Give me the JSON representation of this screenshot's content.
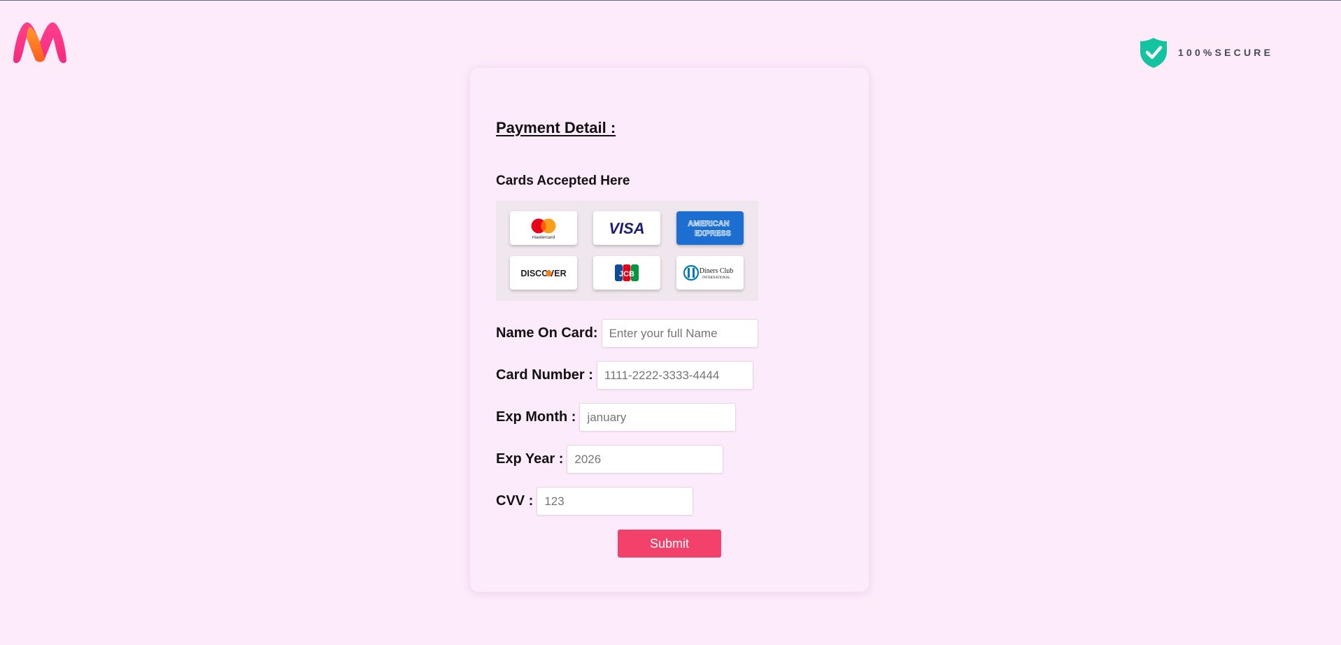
{
  "header": {
    "logo": "myntra-logo",
    "secure_text": "100%SECURE",
    "secure_icon": "shield-check-icon"
  },
  "form": {
    "title": "Payment Detail :",
    "cards_heading": "Cards Accepted Here",
    "card_brands": [
      {
        "name": "mastercard",
        "label": "mastercard"
      },
      {
        "name": "visa",
        "label": "VISA"
      },
      {
        "name": "american-express",
        "label_line1": "AMERICAN",
        "label_line2": "EXPRESS"
      },
      {
        "name": "discover",
        "label": "DISCOVER"
      },
      {
        "name": "jcb",
        "label": "JCB"
      },
      {
        "name": "diners-club",
        "label_line1": "Diners Club",
        "label_line2": "INTERNATIONAL"
      }
    ],
    "fields": {
      "name": {
        "label": "Name On Card:",
        "placeholder": "Enter your full Name",
        "value": ""
      },
      "number": {
        "label": "Card Number :",
        "placeholder": "1111-2222-3333-4444",
        "value": ""
      },
      "month": {
        "label": "Exp Month :",
        "placeholder": "january",
        "value": ""
      },
      "year": {
        "label": "Exp Year :",
        "placeholder": "2026",
        "value": ""
      },
      "cvv": {
        "label": "CVV :",
        "placeholder": "123",
        "value": ""
      }
    },
    "submit_label": "Submit"
  },
  "colors": {
    "page_bg": "#fdebfa",
    "submit": "#f2426b",
    "shield": "#14c3a0",
    "amex": "#1c6fd0"
  }
}
